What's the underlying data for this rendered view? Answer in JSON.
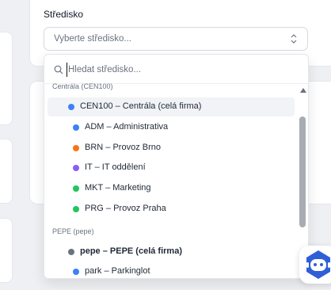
{
  "form": {
    "field_label": "Středisko",
    "select_placeholder": "Vyberte středisko..."
  },
  "dropdown": {
    "search_placeholder": "Hledat středisko...",
    "groups": [
      {
        "header": "Centrála (CEN100)",
        "options": [
          {
            "label": "CEN100 – Centrála (celá firma)",
            "color": "#3b82f6",
            "active": true
          },
          {
            "label": "ADM – Administrativa",
            "color": "#3b82f6"
          },
          {
            "label": "BRN – Provoz Brno",
            "color": "#f97316"
          },
          {
            "label": "IT – IT oddělení",
            "color": "#8b5cf6"
          },
          {
            "label": "MKT – Marketing",
            "color": "#22c55e"
          },
          {
            "label": "PRG – Provoz Praha",
            "color": "#22c55e"
          }
        ]
      },
      {
        "header": "PEPE (pepe)",
        "options": [
          {
            "label": "pepe – PEPE (celá firma)",
            "color": "#6b7280"
          },
          {
            "label": "park – Parkinglot",
            "color": "#3b82f6"
          }
        ]
      }
    ]
  },
  "icons": {
    "search": "search-icon",
    "chevron": "chevron-up-down-icon",
    "chat": "chat-bot-icon"
  },
  "colors": {
    "accent": "#3b82f6",
    "fab_bg": "#2f5fd6"
  }
}
